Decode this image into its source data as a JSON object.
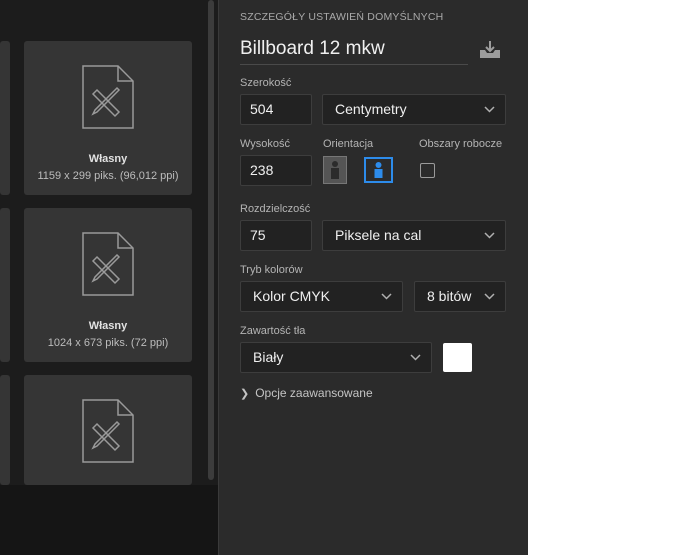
{
  "presets": {
    "cards": [
      {
        "name": "Własny",
        "details": "1159 x 299 piks. (96,012 ppi)"
      },
      {
        "name": "Własny",
        "details": "1024 x 673 piks. (72 ppi)"
      },
      {
        "name": "",
        "details": ""
      }
    ]
  },
  "details": {
    "heading": "SZCZEGÓŁY USTAWIEŃ DOMYŚLNYCH",
    "title": "Billboard 12 mkw",
    "width": {
      "label": "Szerokość",
      "value": "504",
      "unit": "Centymetry"
    },
    "height": {
      "label": "Wysokość",
      "value": "238"
    },
    "orientation": {
      "label": "Orientacja",
      "selected": "landscape"
    },
    "artboards": {
      "label": "Obszary robocze",
      "checked": false
    },
    "resolution": {
      "label": "Rozdzielczość",
      "value": "75",
      "unit": "Piksele na cal"
    },
    "color_mode": {
      "label": "Tryb kolorów",
      "value": "Kolor CMYK",
      "depth": "8 bitów"
    },
    "background": {
      "label": "Zawartość tła",
      "value": "Biały",
      "swatch_color": "#ffffff"
    },
    "advanced_label": "Opcje zaawansowane"
  },
  "colors": {
    "accent": "#2d8ceb",
    "panel_bg": "#2b2b2b",
    "field_bg": "#222222"
  }
}
